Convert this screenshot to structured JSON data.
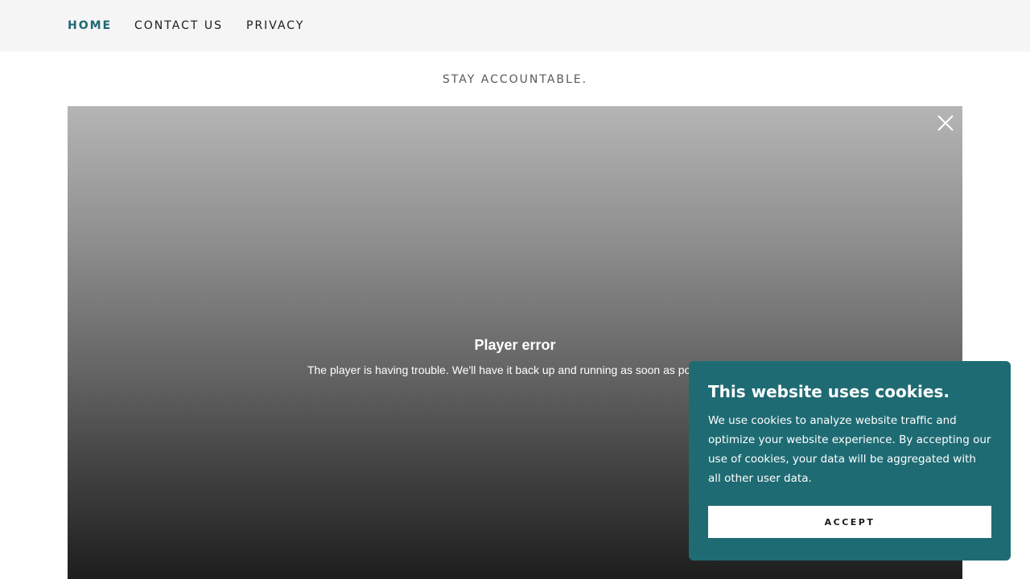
{
  "nav": {
    "items": [
      {
        "label": "HOME",
        "active": true
      },
      {
        "label": "CONTACT US",
        "active": false
      },
      {
        "label": "PRIVACY",
        "active": false
      }
    ]
  },
  "hero": {
    "tagline": "STAY ACCOUNTABLE."
  },
  "player": {
    "close_icon": "close-icon",
    "error_title": "Player error",
    "error_message": "The player is having trouble. We'll have it back up and running as soon as possible."
  },
  "cookie_banner": {
    "title": "This website uses cookies.",
    "body": "We use cookies to analyze website traffic and optimize your website experience. By accepting our use of cookies, your data will be aggregated with all other user data.",
    "accept_label": "ACCEPT"
  },
  "colors": {
    "accent": "#1d6873",
    "banner_bg": "#1e6b73",
    "nav_bg": "#f5f5f5"
  }
}
